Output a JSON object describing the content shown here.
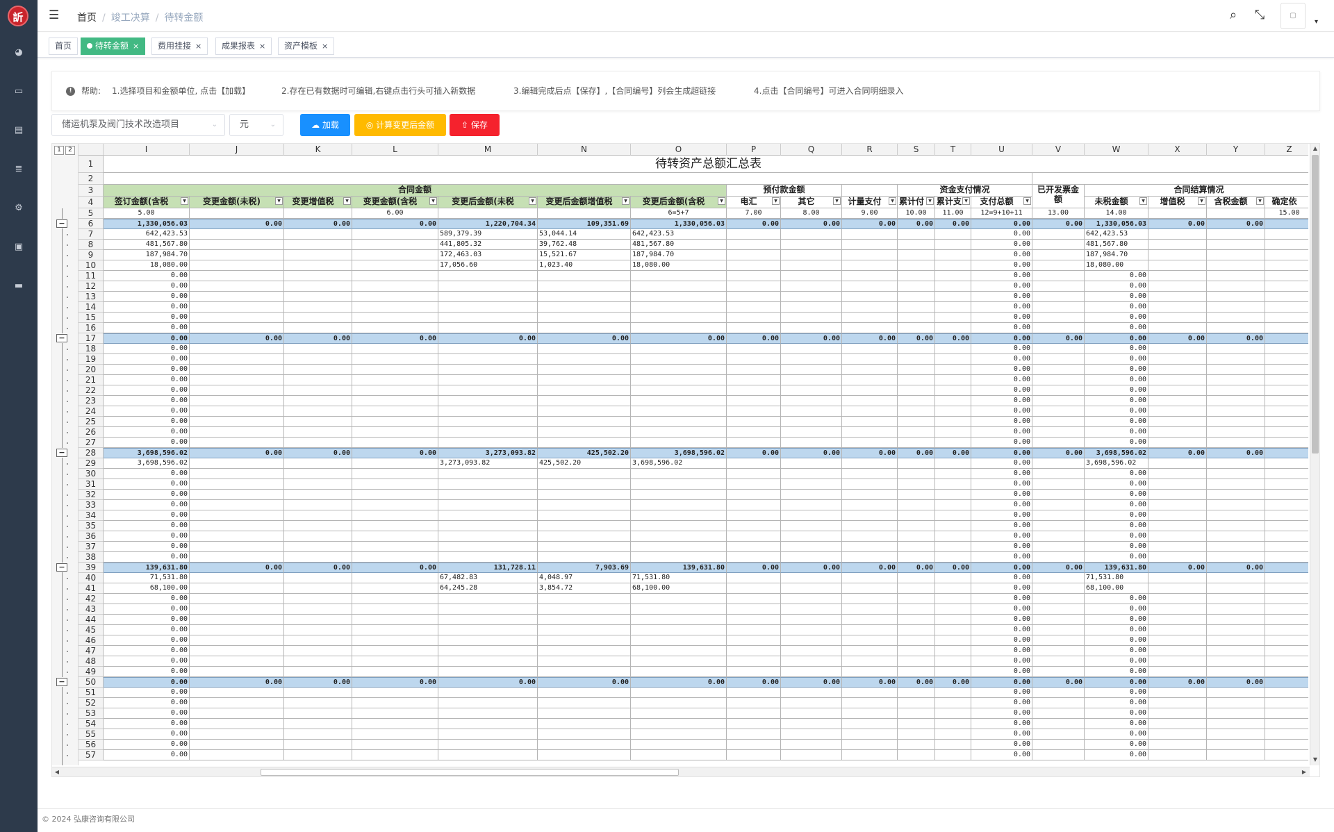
{
  "logo": {
    "text": "訢"
  },
  "sidebar": {
    "icons": [
      "dashboard-icon",
      "monitor-icon",
      "document-icon",
      "database-icon",
      "gear-icon",
      "screen-icon",
      "card-icon"
    ]
  },
  "breadcrumb": [
    "首页",
    "竣工决算",
    "待转金额"
  ],
  "tags": [
    {
      "label": "首页",
      "active": false,
      "closable": false
    },
    {
      "label": "待转金额",
      "active": true,
      "closable": true
    },
    {
      "label": "费用挂接",
      "active": false,
      "closable": true
    },
    {
      "label": "成果报表",
      "active": false,
      "closable": true
    },
    {
      "label": "资产模板",
      "active": false,
      "closable": true
    }
  ],
  "help": {
    "label": "帮助:",
    "items": [
      "1.选择项目和金额单位, 点击【加载】",
      "2.存在已有数据时可编辑,右键点击行头可插入新数据",
      "3.编辑完成后点【保存】,【合同编号】列会生成超链接",
      "4.点击【合同编号】可进入合同明细录入"
    ]
  },
  "controls": {
    "project": "储运机泵及阀门技术改造项目",
    "unit": "元",
    "load": "加载",
    "calc": "计算变更后金额",
    "save": "保存"
  },
  "sheet": {
    "outline_levels": [
      "1",
      "2"
    ],
    "columns": [
      "I",
      "J",
      "K",
      "L",
      "M",
      "N",
      "O",
      "P",
      "Q",
      "R",
      "S",
      "T",
      "U",
      "V",
      "W",
      "X",
      "Y",
      "Z"
    ],
    "title": "待转资产总额汇总表",
    "groups": {
      "contract": "合同金额",
      "prepay": "预付款金额",
      "payment": "资金支付情况",
      "invoiced": "已开发票金额",
      "settle": "合同结算情况"
    },
    "fields": [
      "签订金额(含税",
      "变更金额(未税)",
      "变更增值税",
      "变更金额(含税",
      "变更后金额(未税",
      "变更后金额增值税",
      "变更后金额(含税",
      "电汇",
      "其它",
      "计量支付",
      "累计付",
      "累计支",
      "支付总额",
      "",
      "未税金额",
      "增值税",
      "含税金额",
      "确定依"
    ],
    "formula_row": [
      "5.00",
      "",
      "",
      "6.00",
      "",
      "",
      "6=5+7",
      "7.00",
      "8.00",
      "9.00",
      "10.00",
      "11.00",
      "12=9+10+11",
      "13.00",
      "14.00",
      "",
      "",
      "15.00"
    ],
    "rows": [
      {
        "n": "6",
        "t": "s",
        "v": [
          "1,330,056.03",
          "0.00",
          "0.00",
          "0.00",
          "1,220,704.34",
          "109,351.69",
          "1,330,056.03",
          "0.00",
          "0.00",
          "0.00",
          "0.00",
          "0.00",
          "0.00",
          "0.00",
          "1,330,056.03",
          "0.00",
          "0.00"
        ]
      },
      {
        "n": "7",
        "v": [
          "642,423.53",
          "",
          "",
          "",
          "589,379.39",
          "53,044.14",
          "642,423.53",
          "",
          "",
          "",
          "",
          "",
          "0.00",
          "",
          "642,423.53"
        ]
      },
      {
        "n": "8",
        "v": [
          "481,567.80",
          "",
          "",
          "",
          "441,805.32",
          "39,762.48",
          "481,567.80",
          "",
          "",
          "",
          "",
          "",
          "0.00",
          "",
          "481,567.80"
        ]
      },
      {
        "n": "9",
        "v": [
          "187,984.70",
          "",
          "",
          "",
          "172,463.03",
          "15,521.67",
          "187,984.70",
          "",
          "",
          "",
          "",
          "",
          "0.00",
          "",
          "187,984.70"
        ]
      },
      {
        "n": "10",
        "v": [
          "18,080.00",
          "",
          "",
          "",
          "17,056.60",
          "1,023.40",
          "18,080.00",
          "",
          "",
          "",
          "",
          "",
          "0.00",
          "",
          "18,080.00"
        ]
      },
      {
        "n": "11",
        "v": [
          "0.00",
          "",
          "",
          "",
          "",
          "",
          "",
          "",
          "",
          "",
          "",
          "",
          "0.00",
          "",
          "0.00"
        ]
      },
      {
        "n": "12",
        "v": [
          "0.00",
          "",
          "",
          "",
          "",
          "",
          "",
          "",
          "",
          "",
          "",
          "",
          "0.00",
          "",
          "0.00"
        ]
      },
      {
        "n": "13",
        "v": [
          "0.00",
          "",
          "",
          "",
          "",
          "",
          "",
          "",
          "",
          "",
          "",
          "",
          "0.00",
          "",
          "0.00"
        ]
      },
      {
        "n": "14",
        "v": [
          "0.00",
          "",
          "",
          "",
          "",
          "",
          "",
          "",
          "",
          "",
          "",
          "",
          "0.00",
          "",
          "0.00"
        ]
      },
      {
        "n": "15",
        "v": [
          "0.00",
          "",
          "",
          "",
          "",
          "",
          "",
          "",
          "",
          "",
          "",
          "",
          "0.00",
          "",
          "0.00"
        ]
      },
      {
        "n": "16",
        "v": [
          "0.00",
          "",
          "",
          "",
          "",
          "",
          "",
          "",
          "",
          "",
          "",
          "",
          "0.00",
          "",
          "0.00"
        ]
      },
      {
        "n": "17",
        "t": "s",
        "v": [
          "0.00",
          "0.00",
          "0.00",
          "0.00",
          "0.00",
          "0.00",
          "0.00",
          "0.00",
          "0.00",
          "0.00",
          "0.00",
          "0.00",
          "0.00",
          "0.00",
          "0.00",
          "0.00",
          "0.00"
        ]
      },
      {
        "n": "18",
        "v": [
          "0.00",
          "",
          "",
          "",
          "",
          "",
          "",
          "",
          "",
          "",
          "",
          "",
          "0.00",
          "",
          "0.00"
        ]
      },
      {
        "n": "19",
        "v": [
          "0.00",
          "",
          "",
          "",
          "",
          "",
          "",
          "",
          "",
          "",
          "",
          "",
          "0.00",
          "",
          "0.00"
        ]
      },
      {
        "n": "20",
        "v": [
          "0.00",
          "",
          "",
          "",
          "",
          "",
          "",
          "",
          "",
          "",
          "",
          "",
          "0.00",
          "",
          "0.00"
        ]
      },
      {
        "n": "21",
        "v": [
          "0.00",
          "",
          "",
          "",
          "",
          "",
          "",
          "",
          "",
          "",
          "",
          "",
          "0.00",
          "",
          "0.00"
        ]
      },
      {
        "n": "22",
        "v": [
          "0.00",
          "",
          "",
          "",
          "",
          "",
          "",
          "",
          "",
          "",
          "",
          "",
          "0.00",
          "",
          "0.00"
        ]
      },
      {
        "n": "23",
        "v": [
          "0.00",
          "",
          "",
          "",
          "",
          "",
          "",
          "",
          "",
          "",
          "",
          "",
          "0.00",
          "",
          "0.00"
        ]
      },
      {
        "n": "24",
        "v": [
          "0.00",
          "",
          "",
          "",
          "",
          "",
          "",
          "",
          "",
          "",
          "",
          "",
          "0.00",
          "",
          "0.00"
        ]
      },
      {
        "n": "25",
        "v": [
          "0.00",
          "",
          "",
          "",
          "",
          "",
          "",
          "",
          "",
          "",
          "",
          "",
          "0.00",
          "",
          "0.00"
        ]
      },
      {
        "n": "26",
        "v": [
          "0.00",
          "",
          "",
          "",
          "",
          "",
          "",
          "",
          "",
          "",
          "",
          "",
          "0.00",
          "",
          "0.00"
        ]
      },
      {
        "n": "27",
        "v": [
          "0.00",
          "",
          "",
          "",
          "",
          "",
          "",
          "",
          "",
          "",
          "",
          "",
          "0.00",
          "",
          "0.00"
        ]
      },
      {
        "n": "28",
        "t": "s",
        "v": [
          "3,698,596.02",
          "0.00",
          "0.00",
          "0.00",
          "3,273,093.82",
          "425,502.20",
          "3,698,596.02",
          "0.00",
          "0.00",
          "0.00",
          "0.00",
          "0.00",
          "0.00",
          "0.00",
          "3,698,596.02",
          "0.00",
          "0.00"
        ]
      },
      {
        "n": "29",
        "v": [
          "3,698,596.02",
          "",
          "",
          "",
          "3,273,093.82",
          "425,502.20",
          "3,698,596.02",
          "",
          "",
          "",
          "",
          "",
          "0.00",
          "",
          "3,698,596.02"
        ]
      },
      {
        "n": "30",
        "v": [
          "0.00",
          "",
          "",
          "",
          "",
          "",
          "",
          "",
          "",
          "",
          "",
          "",
          "0.00",
          "",
          "0.00"
        ]
      },
      {
        "n": "31",
        "v": [
          "0.00",
          "",
          "",
          "",
          "",
          "",
          "",
          "",
          "",
          "",
          "",
          "",
          "0.00",
          "",
          "0.00"
        ]
      },
      {
        "n": "32",
        "v": [
          "0.00",
          "",
          "",
          "",
          "",
          "",
          "",
          "",
          "",
          "",
          "",
          "",
          "0.00",
          "",
          "0.00"
        ]
      },
      {
        "n": "33",
        "v": [
          "0.00",
          "",
          "",
          "",
          "",
          "",
          "",
          "",
          "",
          "",
          "",
          "",
          "0.00",
          "",
          "0.00"
        ]
      },
      {
        "n": "34",
        "v": [
          "0.00",
          "",
          "",
          "",
          "",
          "",
          "",
          "",
          "",
          "",
          "",
          "",
          "0.00",
          "",
          "0.00"
        ]
      },
      {
        "n": "35",
        "v": [
          "0.00",
          "",
          "",
          "",
          "",
          "",
          "",
          "",
          "",
          "",
          "",
          "",
          "0.00",
          "",
          "0.00"
        ]
      },
      {
        "n": "36",
        "v": [
          "0.00",
          "",
          "",
          "",
          "",
          "",
          "",
          "",
          "",
          "",
          "",
          "",
          "0.00",
          "",
          "0.00"
        ]
      },
      {
        "n": "37",
        "v": [
          "0.00",
          "",
          "",
          "",
          "",
          "",
          "",
          "",
          "",
          "",
          "",
          "",
          "0.00",
          "",
          "0.00"
        ]
      },
      {
        "n": "38",
        "v": [
          "0.00",
          "",
          "",
          "",
          "",
          "",
          "",
          "",
          "",
          "",
          "",
          "",
          "0.00",
          "",
          "0.00"
        ]
      },
      {
        "n": "39",
        "t": "s",
        "v": [
          "139,631.80",
          "0.00",
          "0.00",
          "0.00",
          "131,728.11",
          "7,903.69",
          "139,631.80",
          "0.00",
          "0.00",
          "0.00",
          "0.00",
          "0.00",
          "0.00",
          "0.00",
          "139,631.80",
          "0.00",
          "0.00"
        ]
      },
      {
        "n": "40",
        "v": [
          "71,531.80",
          "",
          "",
          "",
          "67,482.83",
          "4,048.97",
          "71,531.80",
          "",
          "",
          "",
          "",
          "",
          "0.00",
          "",
          "71,531.80"
        ]
      },
      {
        "n": "41",
        "v": [
          "68,100.00",
          "",
          "",
          "",
          "64,245.28",
          "3,854.72",
          "68,100.00",
          "",
          "",
          "",
          "",
          "",
          "0.00",
          "",
          "68,100.00"
        ]
      },
      {
        "n": "42",
        "v": [
          "0.00",
          "",
          "",
          "",
          "",
          "",
          "",
          "",
          "",
          "",
          "",
          "",
          "0.00",
          "",
          "0.00"
        ]
      },
      {
        "n": "43",
        "v": [
          "0.00",
          "",
          "",
          "",
          "",
          "",
          "",
          "",
          "",
          "",
          "",
          "",
          "0.00",
          "",
          "0.00"
        ]
      },
      {
        "n": "44",
        "v": [
          "0.00",
          "",
          "",
          "",
          "",
          "",
          "",
          "",
          "",
          "",
          "",
          "",
          "0.00",
          "",
          "0.00"
        ]
      },
      {
        "n": "45",
        "v": [
          "0.00",
          "",
          "",
          "",
          "",
          "",
          "",
          "",
          "",
          "",
          "",
          "",
          "0.00",
          "",
          "0.00"
        ]
      },
      {
        "n": "46",
        "v": [
          "0.00",
          "",
          "",
          "",
          "",
          "",
          "",
          "",
          "",
          "",
          "",
          "",
          "0.00",
          "",
          "0.00"
        ]
      },
      {
        "n": "47",
        "v": [
          "0.00",
          "",
          "",
          "",
          "",
          "",
          "",
          "",
          "",
          "",
          "",
          "",
          "0.00",
          "",
          "0.00"
        ]
      },
      {
        "n": "48",
        "v": [
          "0.00",
          "",
          "",
          "",
          "",
          "",
          "",
          "",
          "",
          "",
          "",
          "",
          "0.00",
          "",
          "0.00"
        ]
      },
      {
        "n": "49",
        "v": [
          "0.00",
          "",
          "",
          "",
          "",
          "",
          "",
          "",
          "",
          "",
          "",
          "",
          "0.00",
          "",
          "0.00"
        ]
      },
      {
        "n": "50",
        "t": "s",
        "v": [
          "0.00",
          "0.00",
          "0.00",
          "0.00",
          "0.00",
          "0.00",
          "0.00",
          "0.00",
          "0.00",
          "0.00",
          "0.00",
          "0.00",
          "0.00",
          "0.00",
          "0.00",
          "0.00",
          "0.00"
        ]
      },
      {
        "n": "51",
        "v": [
          "0.00",
          "",
          "",
          "",
          "",
          "",
          "",
          "",
          "",
          "",
          "",
          "",
          "0.00",
          "",
          "0.00"
        ]
      },
      {
        "n": "52",
        "v": [
          "0.00",
          "",
          "",
          "",
          "",
          "",
          "",
          "",
          "",
          "",
          "",
          "",
          "0.00",
          "",
          "0.00"
        ]
      },
      {
        "n": "53",
        "v": [
          "0.00",
          "",
          "",
          "",
          "",
          "",
          "",
          "",
          "",
          "",
          "",
          "",
          "0.00",
          "",
          "0.00"
        ]
      },
      {
        "n": "54",
        "v": [
          "0.00",
          "",
          "",
          "",
          "",
          "",
          "",
          "",
          "",
          "",
          "",
          "",
          "0.00",
          "",
          "0.00"
        ]
      },
      {
        "n": "55",
        "v": [
          "0.00",
          "",
          "",
          "",
          "",
          "",
          "",
          "",
          "",
          "",
          "",
          "",
          "0.00",
          "",
          "0.00"
        ]
      },
      {
        "n": "56",
        "v": [
          "0.00",
          "",
          "",
          "",
          "",
          "",
          "",
          "",
          "",
          "",
          "",
          "",
          "0.00",
          "",
          "0.00"
        ]
      },
      {
        "n": "57",
        "v": [
          "0.00",
          "",
          "",
          "",
          "",
          "",
          "",
          "",
          "",
          "",
          "",
          "",
          "0.00",
          "",
          "0.00"
        ]
      }
    ]
  },
  "footer": "© 2024 弘康咨询有限公司",
  "colors": {
    "sidebar": "#2d3a4b",
    "active_tag": "#42b983",
    "load": "#1890ff",
    "calc": "#ffba00",
    "save": "#f5222d",
    "subtotal": "#bdd7ee",
    "header_green": "#c6e0b4"
  }
}
